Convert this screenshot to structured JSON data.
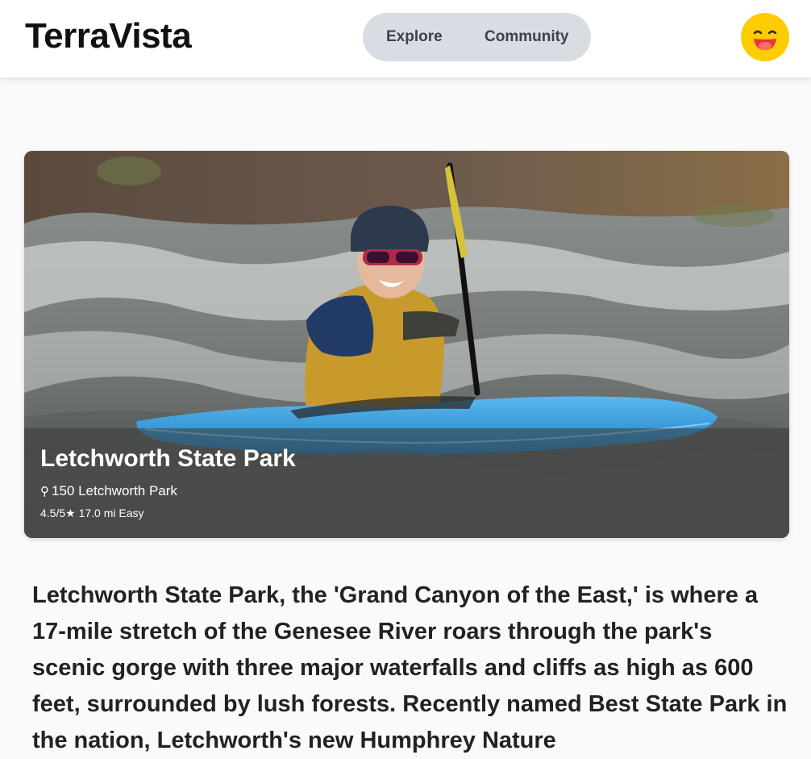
{
  "app": {
    "name": "TerraVista"
  },
  "nav": {
    "items": [
      {
        "label": "Explore"
      },
      {
        "label": "Community"
      }
    ]
  },
  "avatar": {
    "icon": "tongue-out-emoji-icon",
    "color": "#ffcc00"
  },
  "park": {
    "name": "Letchworth State Park",
    "address": "150 Letchworth Park",
    "rating": "4.5/5★",
    "distance": "17.0 mi",
    "difficulty": "Easy",
    "description": "Letchworth State Park, the 'Grand Canyon of the East,' is where a 17-mile stretch of the Genesee River roars through the park's scenic gorge with three major waterfalls and cliffs as high as 600 feet, surrounded by lush forests. Recently named Best State Park in the nation, Letchworth's new Humphrey Nature"
  }
}
